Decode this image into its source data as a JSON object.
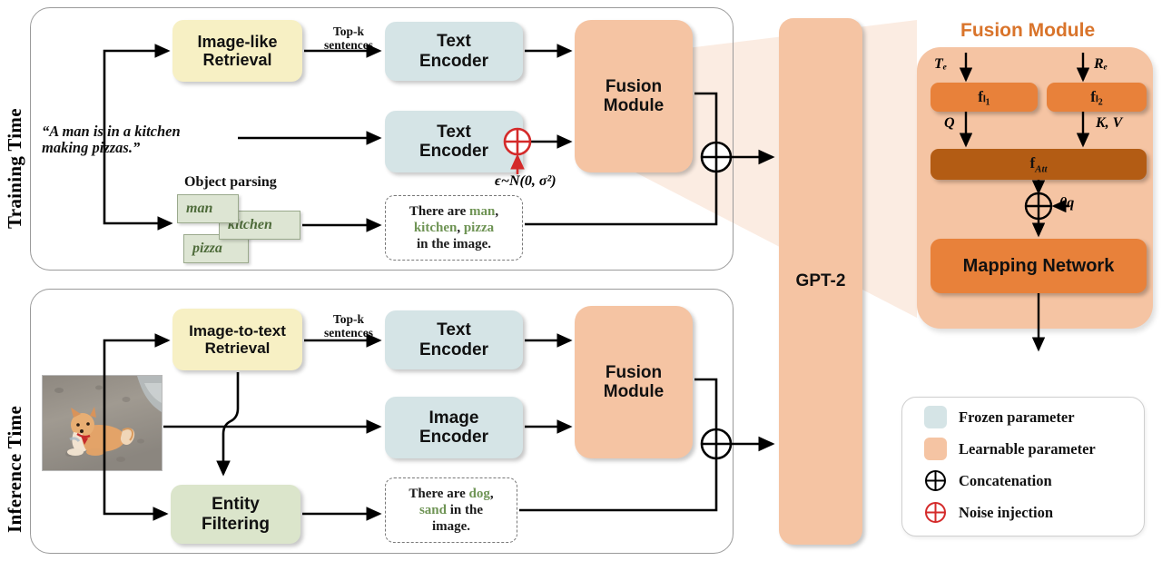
{
  "figure": {
    "sections": [
      {
        "id": "training",
        "label": "Training Time"
      },
      {
        "id": "inference",
        "label": "Inference Time"
      }
    ]
  },
  "training": {
    "caption": "“A man is in a kitchen\nmaking pizzas.”",
    "caption_line1": "“A man is in a kitchen",
    "caption_line2": "making pizzas.”",
    "retrieval": {
      "line1": "Image-like",
      "line2": "Retrieval"
    },
    "topk": {
      "line1": "Top-k",
      "line2": "sentences"
    },
    "text_encoder_top": {
      "line1": "Text",
      "line2": "Encoder"
    },
    "text_encoder_mid": {
      "line1": "Text",
      "line2": "Encoder"
    },
    "fusion": {
      "line1": "Fusion",
      "line2": "Module"
    },
    "object_parsing_label": "Object parsing",
    "tags": [
      "man",
      "kitchen",
      "pizza"
    ],
    "noise_formula": "ϵ~N(0, σ²)",
    "prompt": {
      "part1": "There are ",
      "e1": "man",
      "part2": ",",
      "e2": "kitchen",
      "part3": ", ",
      "e3": "pizza",
      "part4": "in the image.",
      "full": "There are man, kitchen, pizza in the image."
    }
  },
  "inference": {
    "retrieval": {
      "line1": "Image-to-text",
      "line2": "Retrieval"
    },
    "topk": {
      "line1": "Top-k",
      "line2": "sentences"
    },
    "text_encoder": {
      "line1": "Text",
      "line2": "Encoder"
    },
    "image_encoder": {
      "line1": "Image",
      "line2": "Encoder"
    },
    "fusion": {
      "line1": "Fusion",
      "line2": "Module"
    },
    "entity_filtering": {
      "line1": "Entity",
      "line2": "Filtering"
    },
    "image_alt": "photo of a shiba inu dog sitting on sand at the beach",
    "prompt": {
      "part1": "There are ",
      "e1": "dog",
      "part2": ",",
      "e2": "sand",
      "part3": " in the",
      "part4": "image.",
      "full": "There are dog, sand in the image."
    }
  },
  "backbone": {
    "label": "GPT-2"
  },
  "fusion_module": {
    "title": "Fusion Module",
    "input_left": "Tₑ",
    "input_right": "Rₑ",
    "block_left": "fₗ₁",
    "block_right": "fₗ₂",
    "signal_left": "Q",
    "signal_right": "K, V",
    "attention": "f_Att",
    "theta": "θq",
    "mapping_network": "Mapping Network"
  },
  "legend": {
    "items": [
      {
        "label": "Frozen parameter",
        "kind": "swatch",
        "color": "#d5e4e6"
      },
      {
        "label": "Learnable parameter",
        "kind": "swatch",
        "color": "#f5c4a3"
      },
      {
        "label": "Concatenation",
        "kind": "circle",
        "color": "#000000"
      },
      {
        "label": "Noise injection",
        "kind": "circle",
        "color": "#d42a2a"
      }
    ]
  },
  "colors": {
    "frozen": "#d5e4e6",
    "learnable": "#f5c4a3",
    "retrieval_yellow": "#f7f0c4",
    "entity_green": "#dbe5cb",
    "fusion_bar": "#e8813a",
    "fusion_att": "#b35c14",
    "fusion_panel": "#f5c4a3",
    "accent_title": "#d9742b",
    "noise_red": "#d42a2a",
    "entity_text_green": "#6f9455"
  }
}
